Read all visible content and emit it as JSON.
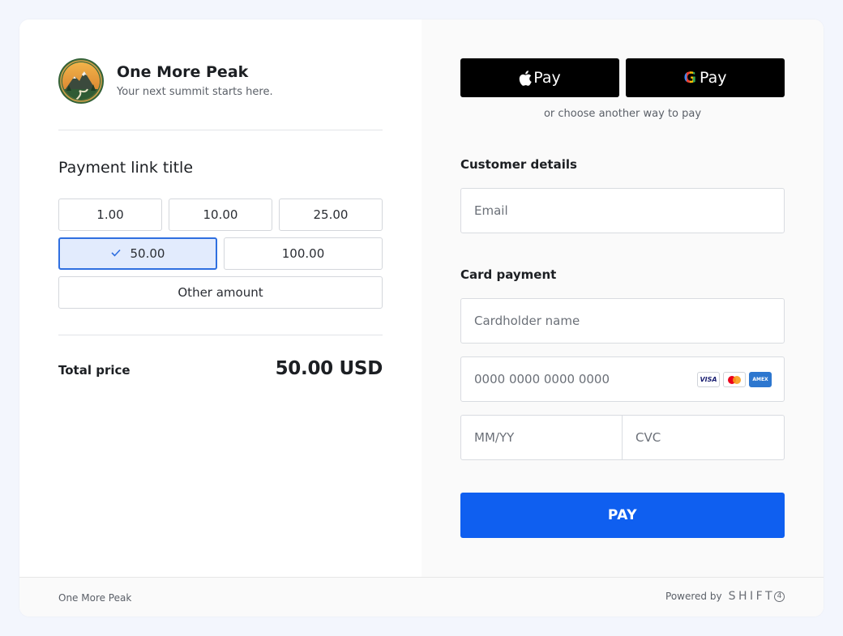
{
  "merchant": {
    "name": "One More Peak",
    "tagline": "Your next summit starts here."
  },
  "payment_link": {
    "title": "Payment link title",
    "amounts": [
      "1.00",
      "10.00",
      "25.00",
      "50.00",
      "100.00"
    ],
    "selected_amount": "50.00",
    "other_label": "Other amount"
  },
  "total": {
    "label": "Total price",
    "value": "50.00 USD"
  },
  "wallets": {
    "apple_label": "Pay",
    "google_label": "Pay",
    "google_g": "G",
    "separator": "or choose another way to pay"
  },
  "customer": {
    "section": "Customer details",
    "email_placeholder": "Email"
  },
  "card": {
    "section": "Card payment",
    "name_placeholder": "Cardholder name",
    "number_placeholder": "0000 0000 0000 0000",
    "expiry_placeholder": "MM/YY",
    "cvc_placeholder": "CVC",
    "brands": [
      "VISA",
      "mastercard-icon",
      "AMEX"
    ]
  },
  "pay_button": "PAY",
  "footer": {
    "merchant": "One More Peak",
    "powered_by": "Powered by",
    "provider_word": "SHIFT",
    "provider_digit": "4"
  },
  "colors": {
    "accent": "#0f5ff0",
    "selected_bg": "#e2ebfd",
    "selected_border": "#2f6fe0"
  }
}
